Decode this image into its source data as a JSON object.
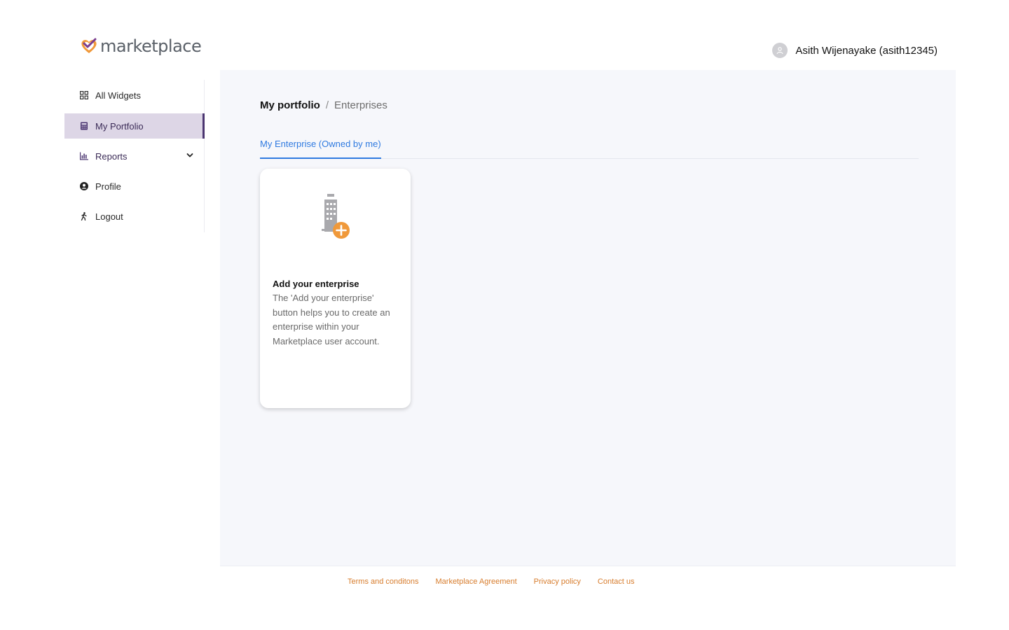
{
  "brand": {
    "name": "marketplace",
    "logo_icon": "heart-check-logo"
  },
  "sidebar": {
    "items": [
      {
        "label": "All Widgets",
        "icon": "grid-icon"
      },
      {
        "label": "My Portfolio",
        "icon": "calculator-icon",
        "active": true
      },
      {
        "label": "Reports",
        "icon": "bar-chart-icon",
        "expandable": true
      },
      {
        "label": "Profile",
        "icon": "user-circle-icon"
      },
      {
        "label": "Logout",
        "icon": "walking-person-icon"
      }
    ]
  },
  "header": {
    "user_name": "Asith Wijenayake (asith12345)",
    "avatar_icon": "user-avatar-icon"
  },
  "breadcrumb": {
    "root": "My portfolio",
    "separator": "/",
    "current": "Enterprises"
  },
  "tabs": [
    {
      "label": "My Enterprise (Owned by me)",
      "active": true
    }
  ],
  "card": {
    "icon": "building-add-icon",
    "title": "Add your enterprise",
    "description": "The 'Add your enterprise' button helps you to create an enterprise within your Marketplace user account."
  },
  "footer": {
    "links": [
      "Terms and conditons",
      "Marketplace Agreement",
      "Privacy policy",
      "Contact us"
    ]
  },
  "colors": {
    "accent_purple": "#4b3571",
    "active_bg": "#ddd6e6",
    "tab_blue": "#2f7ae0",
    "footer_orange": "#d77c2c",
    "plus_orange": "#f0993a",
    "main_bg": "#f6f7fb"
  }
}
